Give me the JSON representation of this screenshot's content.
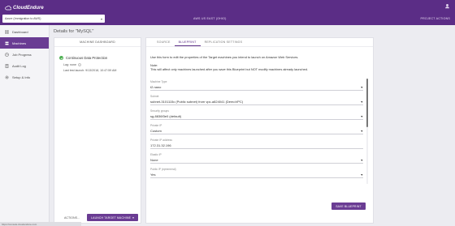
{
  "app": {
    "logo_text": "CloudEndure"
  },
  "header": {
    "project": "Azure (Immigration to AWS)",
    "region": "AWS US EAST (OHIO)",
    "project_actions": "PROJECT ACTIONS"
  },
  "sidebar": {
    "items": [
      {
        "label": "Dashboard",
        "icon": "dashboard-icon",
        "active": false
      },
      {
        "label": "Machines",
        "icon": "server-icon",
        "active": true
      },
      {
        "label": "Job Progress",
        "icon": "clock-icon",
        "active": false
      },
      {
        "label": "Audit Log",
        "icon": "document-icon",
        "active": false
      },
      {
        "label": "Setup & Info",
        "icon": "gear-icon",
        "active": false
      }
    ]
  },
  "main": {
    "title": "Details for \"MySQL\"",
    "left_card": {
      "header": "MACHINE DASHBOARD",
      "status": "Continuous Data Protection",
      "lag": "Lag: none",
      "last_launch": "Last test launch: 9/13/2018, 10:47:59 AM",
      "actions_label": "ACTIONS...",
      "launch_button": "LAUNCH TARGET MACHINE"
    },
    "tabs": [
      {
        "label": "SOURCE",
        "active": false
      },
      {
        "label": "BLUEPRINT",
        "active": true
      },
      {
        "label": "REPLICATION SETTINGS",
        "active": false
      }
    ],
    "blueprint": {
      "intro": "Use this form to edit the properties of the Target machines you intend to launch on Amazon Web Services.",
      "note_title": "Note:",
      "note_text": "This will affect only machines launched after you save this Blueprint but NOT modify machines already launched.",
      "fields": [
        {
          "label": "Machine Type",
          "value": "t2.nano",
          "dropdown": true
        },
        {
          "label": "Subnet",
          "value": "subnet-3101115c (Public subnet) from vpc-a824041 (DemoVPC)",
          "dropdown": true
        },
        {
          "label": "Security groups",
          "value": "sg-8836f3e0 (default)",
          "dropdown": true
        },
        {
          "label": "Private IP",
          "value": "Custom",
          "dropdown": true
        },
        {
          "label": "Private IP address",
          "value": "172.31.32.196",
          "dropdown": false
        },
        {
          "label": "Elastic IP",
          "value": "None",
          "dropdown": true
        },
        {
          "label": "Public IP (ephemeral)",
          "value": "Yes",
          "dropdown": true
        }
      ],
      "save_button": "SAVE BLUEPRINT"
    }
  },
  "status_bar": {
    "url": "https://console.cloudendure.com"
  },
  "colors": {
    "brand": "#5b2d86",
    "accent": "#6a3c93",
    "success": "#4caf50"
  }
}
